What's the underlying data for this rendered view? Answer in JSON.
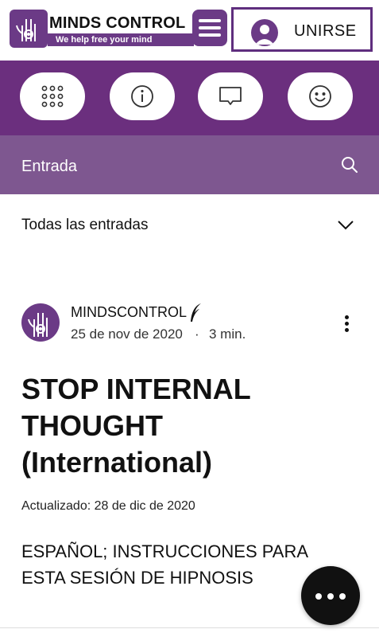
{
  "brand": {
    "name": "MINDS CONTROL",
    "tagline": "We help free your mind",
    "accent_color": "#6b2f7e",
    "band_color": "#7e5790"
  },
  "header": {
    "join_label": "UNIRSE",
    "menu_icon": "hamburger-icon",
    "avatar_icon": "user-avatar-icon"
  },
  "nav_pills": [
    {
      "icon": "apps-grid-icon"
    },
    {
      "icon": "info-icon"
    },
    {
      "icon": "chat-icon"
    },
    {
      "icon": "smiley-icon"
    }
  ],
  "section": {
    "title": "Entrada",
    "search_icon": "search-icon"
  },
  "filter": {
    "selected": "Todas las entradas",
    "icon": "chevron-down-icon"
  },
  "post": {
    "author": "MINDSCONTROL",
    "author_badge_icon": "quill-icon",
    "date": "25 de nov de 2020",
    "separator": "·",
    "read_time": "3 min.",
    "title": "STOP INTERNAL THOUGHT (International)",
    "updated": "Actualizado: 28 de dic de 2020",
    "body": "ESPAÑOL; INSTRUCCIONES PARA ESTA SESIÓN DE HIPNOSIS"
  },
  "fab_icon": "more-horizontal-icon"
}
